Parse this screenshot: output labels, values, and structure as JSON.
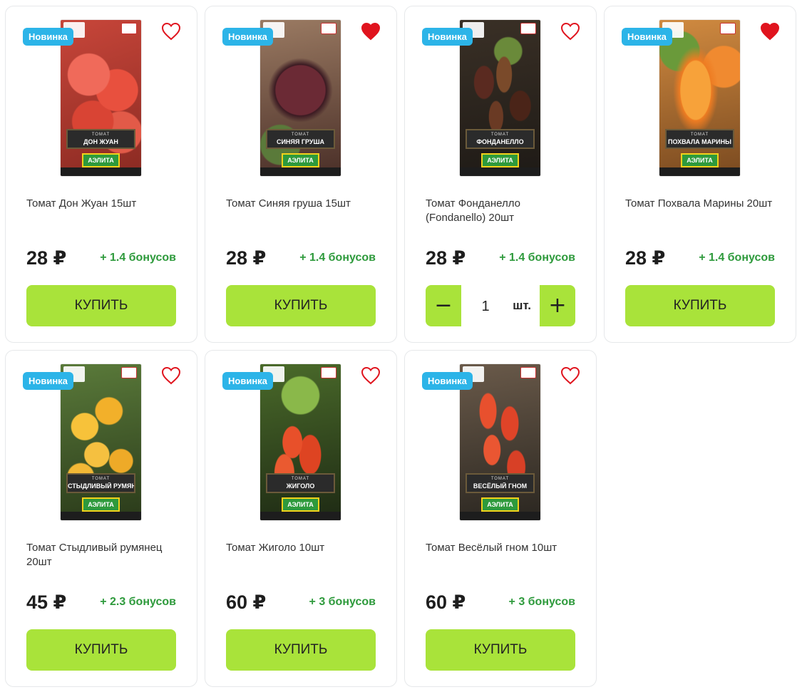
{
  "products": [
    {
      "badge": "Новинка",
      "name": "Томат Дон Жуан 15шт",
      "price": "28 ₽",
      "bonus": "+ 1.4 бонусов",
      "button": "КУПИТЬ",
      "favorite": false,
      "pack": {
        "kind": "ТОМАТ",
        "variety": "ДОН ЖУАН",
        "brand": "АЭЛИТА"
      }
    },
    {
      "badge": "Новинка",
      "name": "Томат Синяя груша 15шт",
      "price": "28 ₽",
      "bonus": "+ 1.4 бонусов",
      "button": "КУПИТЬ",
      "favorite": true,
      "pack": {
        "kind": "ТОМАТ",
        "variety": "СИНЯЯ ГРУША",
        "brand": "АЭЛИТА"
      }
    },
    {
      "badge": "Новинка",
      "name": "Томат Фонданелло (Fondanello) 20шт",
      "price": "28 ₽",
      "bonus": "+ 1.4 бонусов",
      "favorite": false,
      "stepper": {
        "minus": "−",
        "qty": "1",
        "unit": "шт.",
        "plus": "+"
      },
      "pack": {
        "kind": "ТОМАТ",
        "variety": "ФОНДАНЕЛЛО",
        "brand": "АЭЛИТА"
      }
    },
    {
      "badge": "Новинка",
      "name": "Томат Похвала Марины 20шт",
      "price": "28 ₽",
      "bonus": "+ 1.4 бонусов",
      "button": "КУПИТЬ",
      "favorite": true,
      "pack": {
        "kind": "ТОМАТ",
        "variety": "ПОХВАЛА МАРИНЫ",
        "brand": "АЭЛИТА"
      }
    },
    {
      "badge": "Новинка",
      "name": "Томат Стыдливый румянец 20шт",
      "price": "45 ₽",
      "bonus": "+ 2.3 бонусов",
      "button": "КУПИТЬ",
      "favorite": false,
      "pack": {
        "kind": "ТОМАТ",
        "variety": "СТЫДЛИВЫЙ РУМЯНЕЦ",
        "brand": "АЭЛИТА"
      }
    },
    {
      "badge": "Новинка",
      "name": "Томат Жиголо 10шт",
      "price": "60 ₽",
      "bonus": "+ 3 бонусов",
      "button": "КУПИТЬ",
      "favorite": false,
      "pack": {
        "kind": "ТОМАТ",
        "variety": "ЖИГОЛО",
        "brand": "АЭЛИТА"
      }
    },
    {
      "badge": "Новинка",
      "name": "Томат Весёлый гном 10шт",
      "price": "60 ₽",
      "bonus": "+ 3 бонусов",
      "button": "КУПИТЬ",
      "favorite": false,
      "pack": {
        "kind": "ТОМАТ",
        "variety": "ВЕСЁЛЫЙ ГНОМ",
        "brand": "АЭЛИТА"
      }
    }
  ],
  "colors": {
    "badge": "#2cb4e8",
    "buy_button": "#a9e33a",
    "bonus_text": "#2e9a3c",
    "favorite_active": "#e0141e",
    "favorite_outline": "#e0141e"
  },
  "icons": {
    "favorite": "heart-icon",
    "decrement": "minus-icon",
    "increment": "plus-icon"
  }
}
